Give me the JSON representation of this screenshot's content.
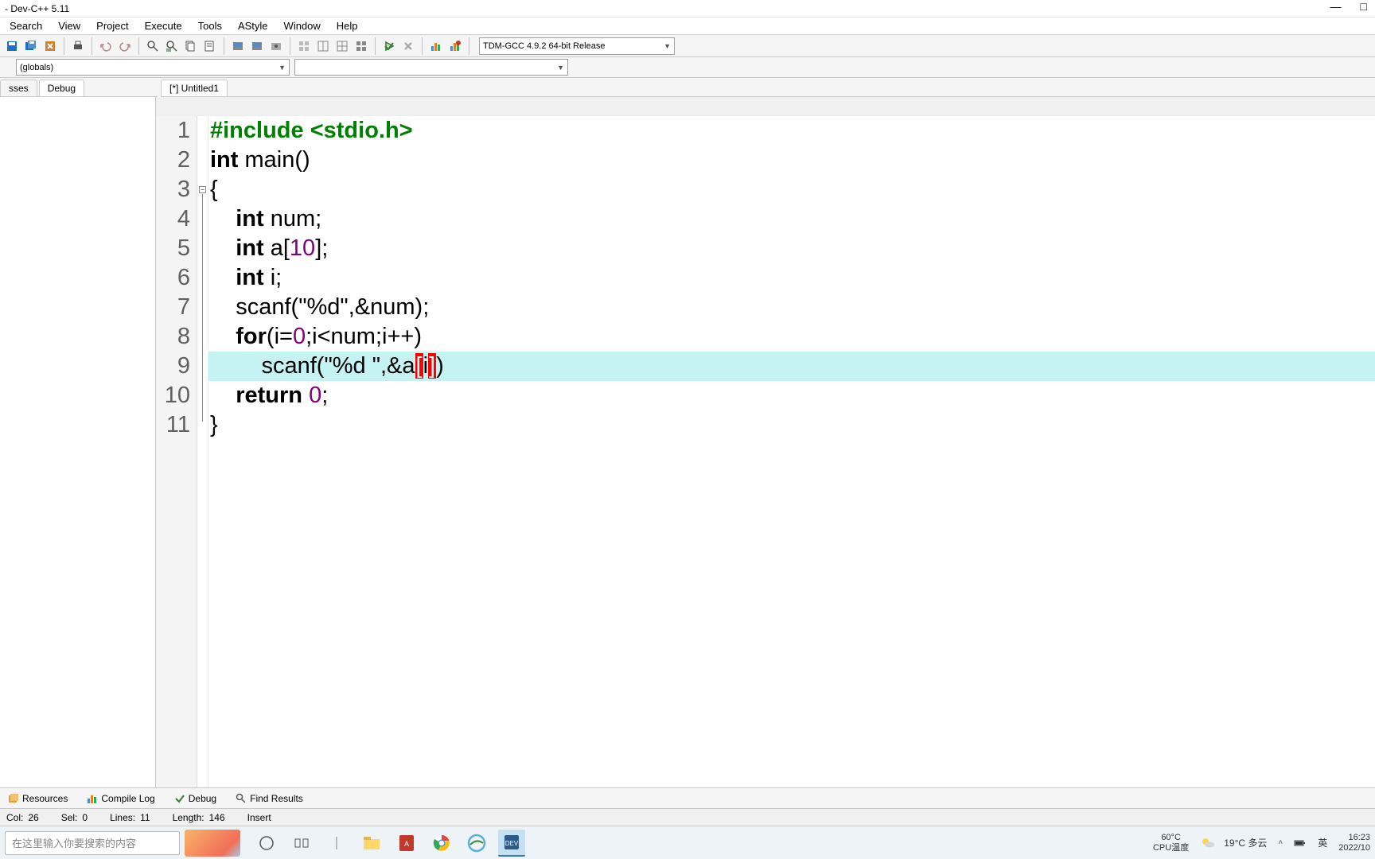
{
  "title": "- Dev-C++ 5.11",
  "menu": [
    "Search",
    "View",
    "Project",
    "Execute",
    "Tools",
    "AStyle",
    "Window",
    "Help"
  ],
  "compiler_combo": "TDM-GCC 4.9.2 64-bit Release",
  "globals_combo": "(globals)",
  "side_tabs": {
    "left": "sses",
    "active": "Debug"
  },
  "editor_tab": "[*] Untitled1",
  "code": {
    "lines": [
      {
        "n": 1,
        "tokens": [
          {
            "t": "#include <stdio.h>",
            "c": "pp"
          }
        ]
      },
      {
        "n": 2,
        "tokens": [
          {
            "t": "int",
            "c": "kw"
          },
          {
            "t": " main()",
            "c": ""
          }
        ]
      },
      {
        "n": 3,
        "tokens": [
          {
            "t": "{",
            "c": ""
          }
        ],
        "fold": true
      },
      {
        "n": 4,
        "tokens": [
          {
            "t": "    ",
            "c": ""
          },
          {
            "t": "int",
            "c": "kw"
          },
          {
            "t": " num;",
            "c": ""
          }
        ]
      },
      {
        "n": 5,
        "tokens": [
          {
            "t": "    ",
            "c": ""
          },
          {
            "t": "int",
            "c": "kw"
          },
          {
            "t": " a[",
            "c": ""
          },
          {
            "t": "10",
            "c": "num"
          },
          {
            "t": "];",
            "c": ""
          }
        ]
      },
      {
        "n": 6,
        "tokens": [
          {
            "t": "    ",
            "c": ""
          },
          {
            "t": "int",
            "c": "kw"
          },
          {
            "t": " i;",
            "c": ""
          }
        ]
      },
      {
        "n": 7,
        "tokens": [
          {
            "t": "    scanf(",
            "c": ""
          },
          {
            "t": "\"%d\"",
            "c": "str"
          },
          {
            "t": ",&num);",
            "c": ""
          }
        ]
      },
      {
        "n": 8,
        "tokens": [
          {
            "t": "    ",
            "c": ""
          },
          {
            "t": "for",
            "c": "kw"
          },
          {
            "t": "(i=",
            "c": ""
          },
          {
            "t": "0",
            "c": "num"
          },
          {
            "t": ";i<num;i++)",
            "c": ""
          }
        ]
      },
      {
        "n": 9,
        "tokens": [
          {
            "t": "        scanf(",
            "c": ""
          },
          {
            "t": "\"%d \"",
            "c": "str"
          },
          {
            "t": ",&a",
            "c": ""
          },
          {
            "t": "[",
            "c": "bracket-hi"
          },
          {
            "t": "i",
            "c": ""
          },
          {
            "t": "]",
            "c": "bracket-hi"
          },
          {
            "t": ")",
            "c": ""
          }
        ],
        "current": true
      },
      {
        "n": 10,
        "tokens": [
          {
            "t": "    ",
            "c": ""
          },
          {
            "t": "return",
            "c": "kw"
          },
          {
            "t": " ",
            "c": ""
          },
          {
            "t": "0",
            "c": "num"
          },
          {
            "t": ";",
            "c": ""
          }
        ]
      },
      {
        "n": 11,
        "tokens": [
          {
            "t": "}",
            "c": ""
          }
        ]
      }
    ]
  },
  "bottom_tabs": [
    "Resources",
    "Compile Log",
    "Debug",
    "Find Results"
  ],
  "status": {
    "col_label": "Col:",
    "col": "26",
    "sel_label": "Sel:",
    "sel": "0",
    "lines_label": "Lines:",
    "lines": "11",
    "length_label": "Length:",
    "length": "146",
    "mode": "Insert"
  },
  "taskbar": {
    "search_placeholder": "在这里输入你要搜索的内容",
    "weather": "19°C 多云",
    "temp_label": "60°C",
    "cpu_label": "CPU温度",
    "ime": "英",
    "time": "16:23",
    "date": "2022/10"
  }
}
